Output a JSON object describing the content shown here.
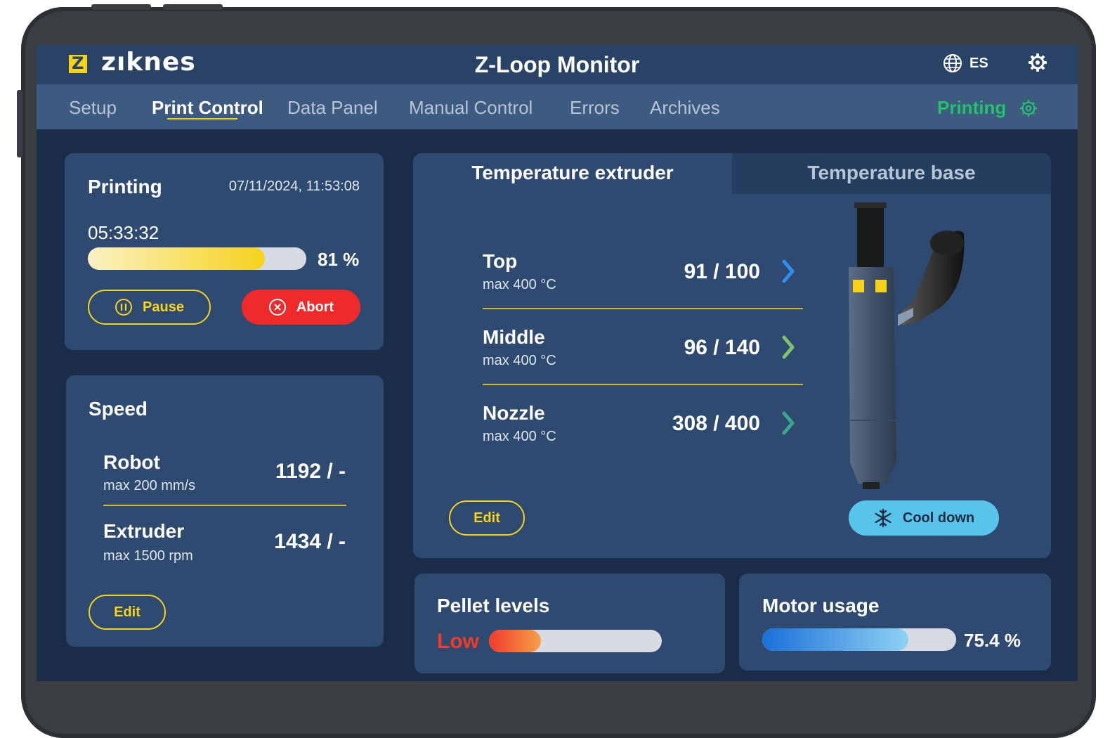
{
  "brand": {
    "logo_mark": "Z",
    "logo_text": "zıknes"
  },
  "app_title": "Z-Loop Monitor",
  "language": "ES",
  "nav": {
    "tabs": [
      {
        "label": "Setup"
      },
      {
        "label": "Print Control"
      },
      {
        "label": "Data Panel"
      },
      {
        "label": "Manual Control"
      },
      {
        "label": "Errors"
      },
      {
        "label": "Archives"
      }
    ],
    "active_tab": "Print Control",
    "status_label": "Printing"
  },
  "print_job": {
    "title": "Printing",
    "datetime": "07/11/2024, 11:53:08",
    "elapsed": "05:33:32",
    "progress_percent": 81,
    "progress_label": "81 %",
    "pause_label": "Pause",
    "abort_label": "Abort"
  },
  "speed": {
    "title": "Speed",
    "rows": [
      {
        "label": "Robot",
        "max": "max 200 mm/s",
        "value": "1192 / -"
      },
      {
        "label": "Extruder",
        "max": "max 1500 rpm",
        "value": "1434 / -"
      }
    ],
    "edit_label": "Edit"
  },
  "temperature": {
    "tabs": [
      {
        "label": "Temperature extruder"
      },
      {
        "label": "Temperature base"
      }
    ],
    "active_tab": "Temperature extruder",
    "rows": [
      {
        "label": "Top",
        "max": "max 400 °C",
        "value": "91 / 100",
        "chevron_color": "#2f8df2"
      },
      {
        "label": "Middle",
        "max": "max 400 °C",
        "value": "96 / 140",
        "chevron_color": "#7fc36e"
      },
      {
        "label": "Nozzle",
        "max": "max 400 °C",
        "value": "308 / 400",
        "chevron_color": "#3aa590"
      }
    ],
    "edit_label": "Edit",
    "cool_down_label": "Cool down"
  },
  "pellet_levels": {
    "title": "Pellet levels",
    "status": "Low",
    "level_percent": 30
  },
  "motor_usage": {
    "title": "Motor usage",
    "percent": 75.4,
    "label": "75.4 %"
  },
  "colors": {
    "accent": "#f6d31b",
    "success": "#24c26a",
    "danger": "#ef2a2a",
    "info": "#58c4ea",
    "background": "#1a2c47",
    "card": "#2e4a70"
  }
}
